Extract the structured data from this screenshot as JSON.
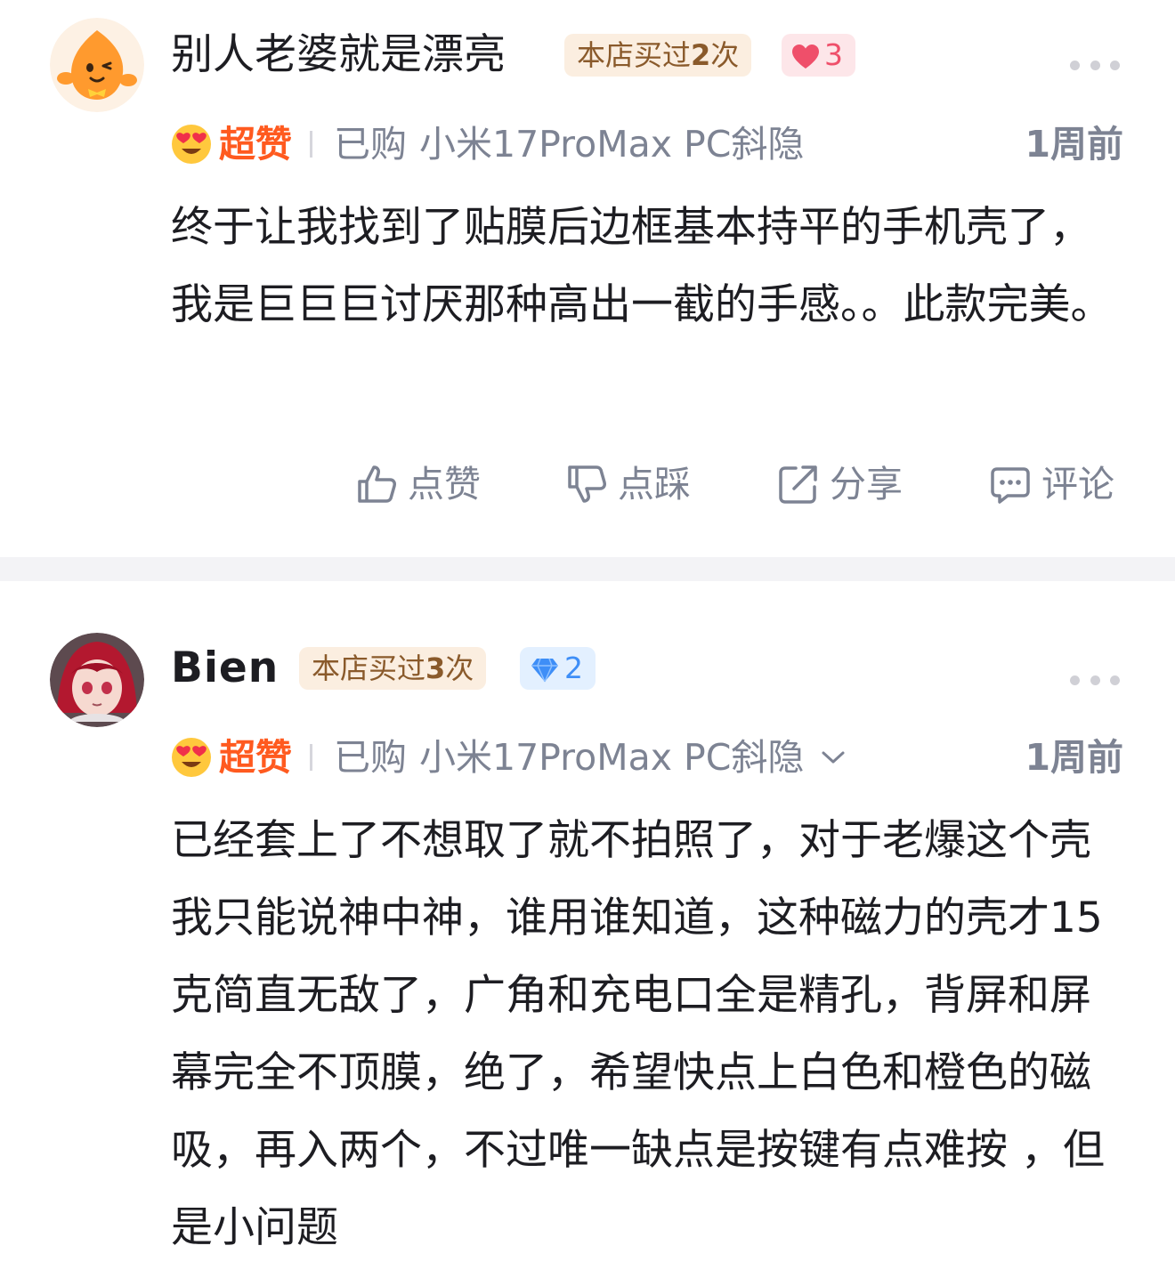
{
  "reviews": [
    {
      "user_name": "别人老婆就是漂亮",
      "bought_prefix": "本店买过",
      "bought_count": "2",
      "bought_suffix": "次",
      "badge_count": "3",
      "badge_icon": "heart-icon",
      "rating_label": "超赞",
      "purchase_prefix": "已购",
      "purchase_model": "小米17ProMax PC斜隐",
      "time": "1周前",
      "content": "终于让我找到了贴膜后边框基本持平的手机壳了，我是巨巨巨讨厌那种高出一截的手感。。此款完美。",
      "actions": {
        "like": "点赞",
        "dislike": "点踩",
        "share": "分享",
        "comment": "评论"
      }
    },
    {
      "user_name": "Bien",
      "bought_prefix": "本店买过",
      "bought_count": "3",
      "bought_suffix": "次",
      "badge_count": "2",
      "badge_icon": "diamond-icon",
      "rating_label": "超赞",
      "purchase_prefix": "已购",
      "purchase_model": "小米17ProMax PC斜隐",
      "time": "1周前",
      "content": "已经套上了不想取了就不拍照了，对于老爆这个壳我只能说神中神，谁用谁知道，这种磁力的壳才15克简直无敌了，广角和充电口全是精孔，背屏和屏幕完全不顶膜，绝了，希望快点上白色和橙色的磁吸，再入两个，不过唯一缺点是按键有点难按 ，但是小问题"
    }
  ],
  "colors": {
    "rating": "#ff5a1f",
    "meta_gray": "#7d8393",
    "bought_bg": "#fbeee0",
    "heart": "#ef4f6a",
    "diamond": "#3e8ef7"
  }
}
